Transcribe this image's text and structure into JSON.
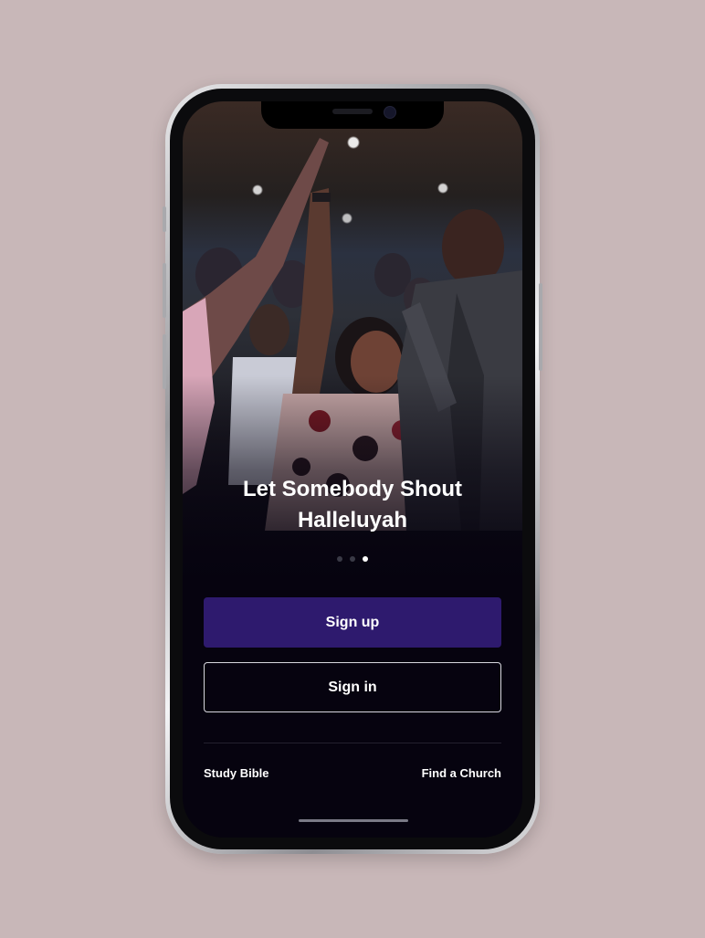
{
  "slide": {
    "headline_line1": "Let Somebody Shout",
    "headline_line2": "Halleluyah",
    "dot_count": 3,
    "active_dot": 3
  },
  "actions": {
    "sign_up_label": "Sign up",
    "sign_in_label": "Sign in"
  },
  "footer": {
    "study_bible_label": "Study Bible",
    "find_church_label": "Find a Church"
  },
  "colors": {
    "background": "#c8b7b8",
    "screen_bg": "#06030f",
    "primary_button": "#2e1a6e",
    "text": "#ffffff"
  }
}
